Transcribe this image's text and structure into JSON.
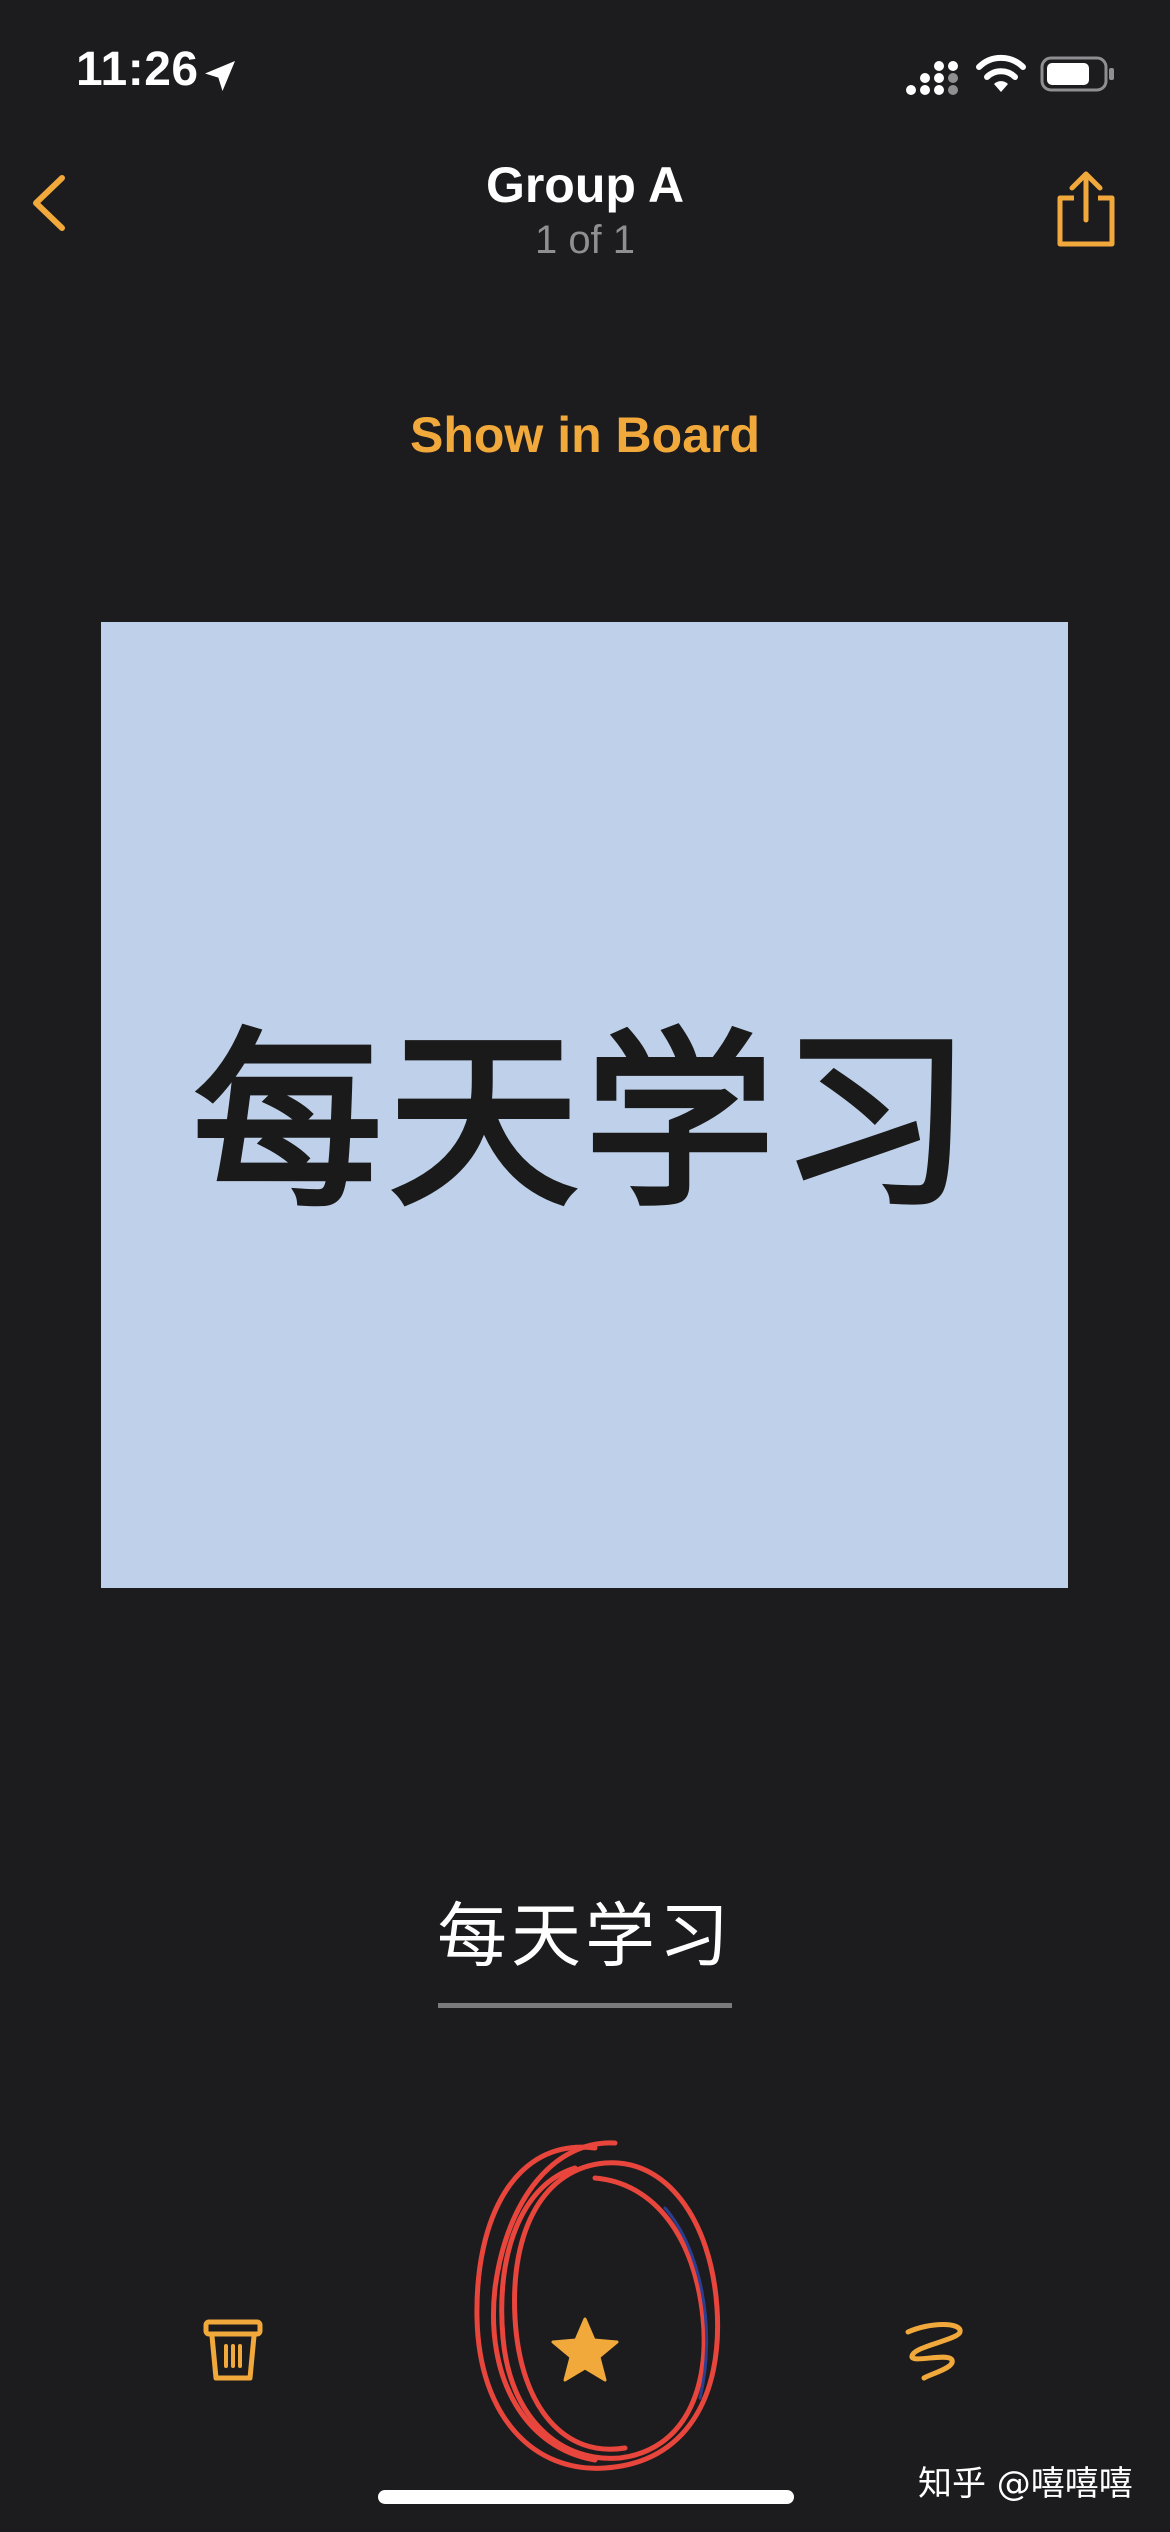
{
  "status_bar": {
    "time": "11:26",
    "icons": [
      "location-arrow-icon",
      "cellular-signal-icon",
      "wifi-icon",
      "battery-icon"
    ]
  },
  "nav": {
    "title": "Group A",
    "subtitle": "1 of 1",
    "back_icon": "chevron-left-icon",
    "share_icon": "share-icon"
  },
  "show_in_board": "Show in Board",
  "card": {
    "text": "每天学习",
    "background": "#bfd1ea"
  },
  "caption": "每天学习",
  "toolbar": {
    "items": [
      "trash-icon",
      "star-icon",
      "scribble-icon"
    ]
  },
  "watermark": "知乎 @嘻嘻嘻",
  "colors": {
    "accent": "#f2a93b",
    "background": "#1c1c1e",
    "annotation": "#e8453c"
  }
}
